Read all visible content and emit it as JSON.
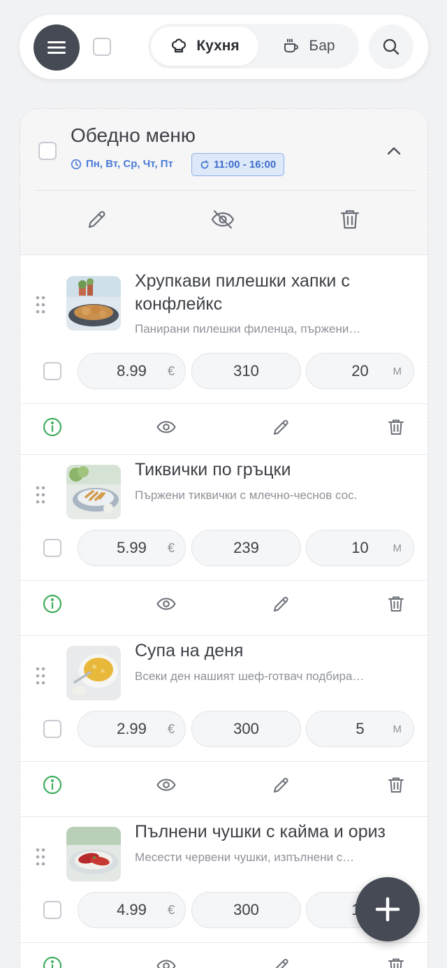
{
  "header": {
    "tabs": [
      {
        "label": "Кухня",
        "active": true,
        "icon": "chef-hat-icon"
      },
      {
        "label": "Бар",
        "active": false,
        "icon": "cup-icon"
      }
    ]
  },
  "menu": {
    "title": "Обедно меню",
    "days": "Пн, Вт, Ср, Чт, Пт",
    "time": "11:00 - 16:00",
    "accent_color": "#4b7bd6",
    "items": [
      {
        "name": "Хрупкави пилешки хапки с конфлейкс",
        "name_line1": "Хрупкави пилешки хапки с",
        "name_line2": "конфлейкс",
        "description": "Панирани пилешки филенца, пържени…",
        "price": "8.99",
        "currency": "€",
        "weight": "310",
        "minutes": "20",
        "minutes_unit": "M"
      },
      {
        "name": "Тиквички по гръцки",
        "description": "Пържени тиквички с млечно-чеснов сос.",
        "price": "5.99",
        "currency": "€",
        "weight": "239",
        "minutes": "10",
        "minutes_unit": "M"
      },
      {
        "name": "Супа на деня",
        "description": "Всеки ден нашият шеф-готвач подбира…",
        "price": "2.99",
        "currency": "€",
        "weight": "300",
        "minutes": "5",
        "minutes_unit": "M"
      },
      {
        "name": "Пълнени чушки с кайма и ориз",
        "description": "Месести червени чушки, изпълнени с…",
        "price": "4.99",
        "currency": "€",
        "weight": "300",
        "minutes": "10",
        "minutes_unit": "M"
      }
    ]
  },
  "status_colors": {
    "info": "#3fae5c",
    "dark": "#454a54"
  }
}
